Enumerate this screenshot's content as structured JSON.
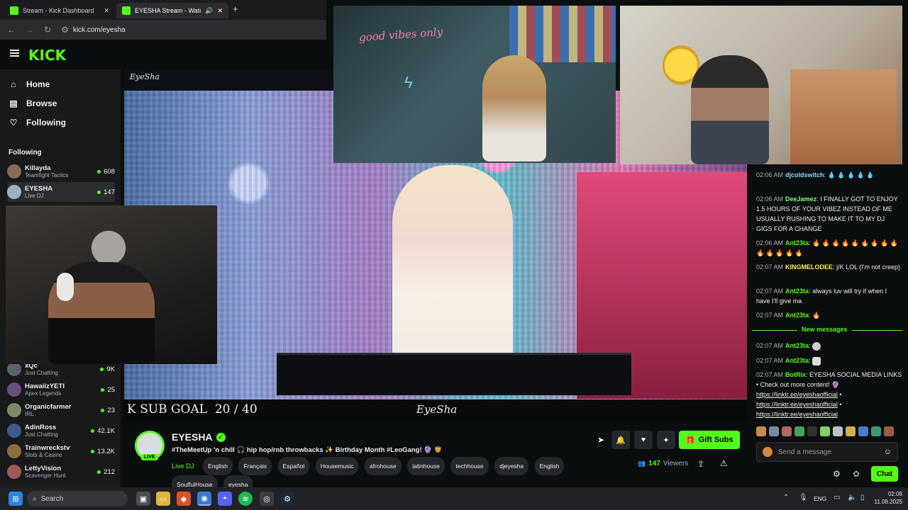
{
  "browser": {
    "tabs": [
      {
        "title": "Stream - Kick Dashboard",
        "close": "✕"
      },
      {
        "title": "EYESHA Stream - Watch Li",
        "close": "✕"
      }
    ],
    "new_tab": "+",
    "url": "kick.com/eyesha"
  },
  "kick": {
    "logo": "KICK",
    "nav": [
      {
        "label": "Home",
        "icon": "home-icon"
      },
      {
        "label": "Browse",
        "icon": "browse-icon"
      },
      {
        "label": "Following",
        "icon": "heart-icon"
      }
    ],
    "following_heading": "Following",
    "following": [
      {
        "name": "Killayda",
        "category": "Teamfight Tactics",
        "viewers": "608"
      },
      {
        "name": "EYESHA",
        "category": "Live DJ",
        "viewers": "147"
      },
      {
        "name": "xQc",
        "category": "Just Chatting",
        "viewers": "9K"
      },
      {
        "name": "HawaiizYETI",
        "category": "Apex Legends",
        "viewers": "25"
      },
      {
        "name": "Organicfarmer",
        "category": "IRL",
        "viewers": "23"
      },
      {
        "name": "AdinRoss",
        "category": "Just Chatting",
        "viewers": "42.1K"
      },
      {
        "name": "Trainwreckstv",
        "category": "Slots & Casino",
        "viewers": "13.2K"
      },
      {
        "name": "LettyVision",
        "category": "Scavenger Hunt",
        "viewers": "212"
      }
    ]
  },
  "player": {
    "watermark": "EyeSha",
    "overlay_goal": "K SUB GOAL  20 / 40",
    "overlay_brand": "EyeSha",
    "neon_sign": "good vibes only"
  },
  "stream": {
    "channel": "EYESHA",
    "live_badge": "LIVE",
    "title": "#TheMeetUp 'n chill 🎧 hip hop/rnb throwbacks ✨ Birthday Month #LeoGang! 🔮 🦁",
    "category": "Live DJ",
    "tags": [
      "English",
      "Français",
      "Español",
      "Housemusic",
      "afrohouse",
      "latinhouse",
      "techhouse",
      "djeyesha",
      "English",
      "SoulfulHouse",
      "eyesha"
    ],
    "viewers": "147",
    "viewers_label": "Viewers",
    "gift_subs": "Gift Subs"
  },
  "chat": {
    "messages": [
      {
        "time": "02:06 AM",
        "user": "djcoldswitch",
        "text": "💧 💧 💧 💧 💧"
      },
      {
        "time": "02:06 AM",
        "user": "DeeJamez",
        "text": "I FINALLY GOT TO ENJOY 1.5 HOURS OF YOUR VIBEZ INSTEAD OF ME USUALLY RUSHING TO MAKE IT TO MY DJ GIGS FOR A CHANGE"
      },
      {
        "time": "02:06 AM",
        "user": "Ant23ta",
        "text": "🔥 🔥 🔥 🔥 🔥 🔥 🔥 🔥 🔥 🔥 🔥 🔥 🔥 🔥"
      },
      {
        "time": "02:07 AM",
        "user": "KINGMELODEE",
        "text": "j/K LOL (I'm not creep)"
      },
      {
        "time": "02:07 AM",
        "user": "Ant23ta",
        "text": "always luv will try if when I have I'll give ma"
      },
      {
        "time": "02:07 AM",
        "user": "Ant23ta",
        "text": "🔥"
      }
    ],
    "new_messages": "New messages",
    "messages_after": [
      {
        "time": "02:07 AM",
        "user": "Ant23ta",
        "text": ""
      },
      {
        "time": "02:07 AM",
        "user": "Ant23ta",
        "text": ""
      },
      {
        "time": "02:07 AM",
        "user": "BotRix",
        "text": "EYESHA SOCIAL MEDIA LINKS • Check out more content! 🔮"
      }
    ],
    "links": [
      "https://linktr.ee/eyeshaofficial",
      "https://linktr.ee/eyeshaofficial",
      "https://linktr.ee/eyeshaofficial"
    ],
    "link_suffix": "•",
    "input_placeholder": "Send a message",
    "send_label": "Chat"
  },
  "taskbar": {
    "search_placeholder": "Search",
    "language": "ENG",
    "time": "02:08",
    "date": "11.08.2025"
  },
  "colors": {
    "accent": "#53fc18",
    "bg": "#0b0e0f",
    "panel": "#18191b"
  }
}
